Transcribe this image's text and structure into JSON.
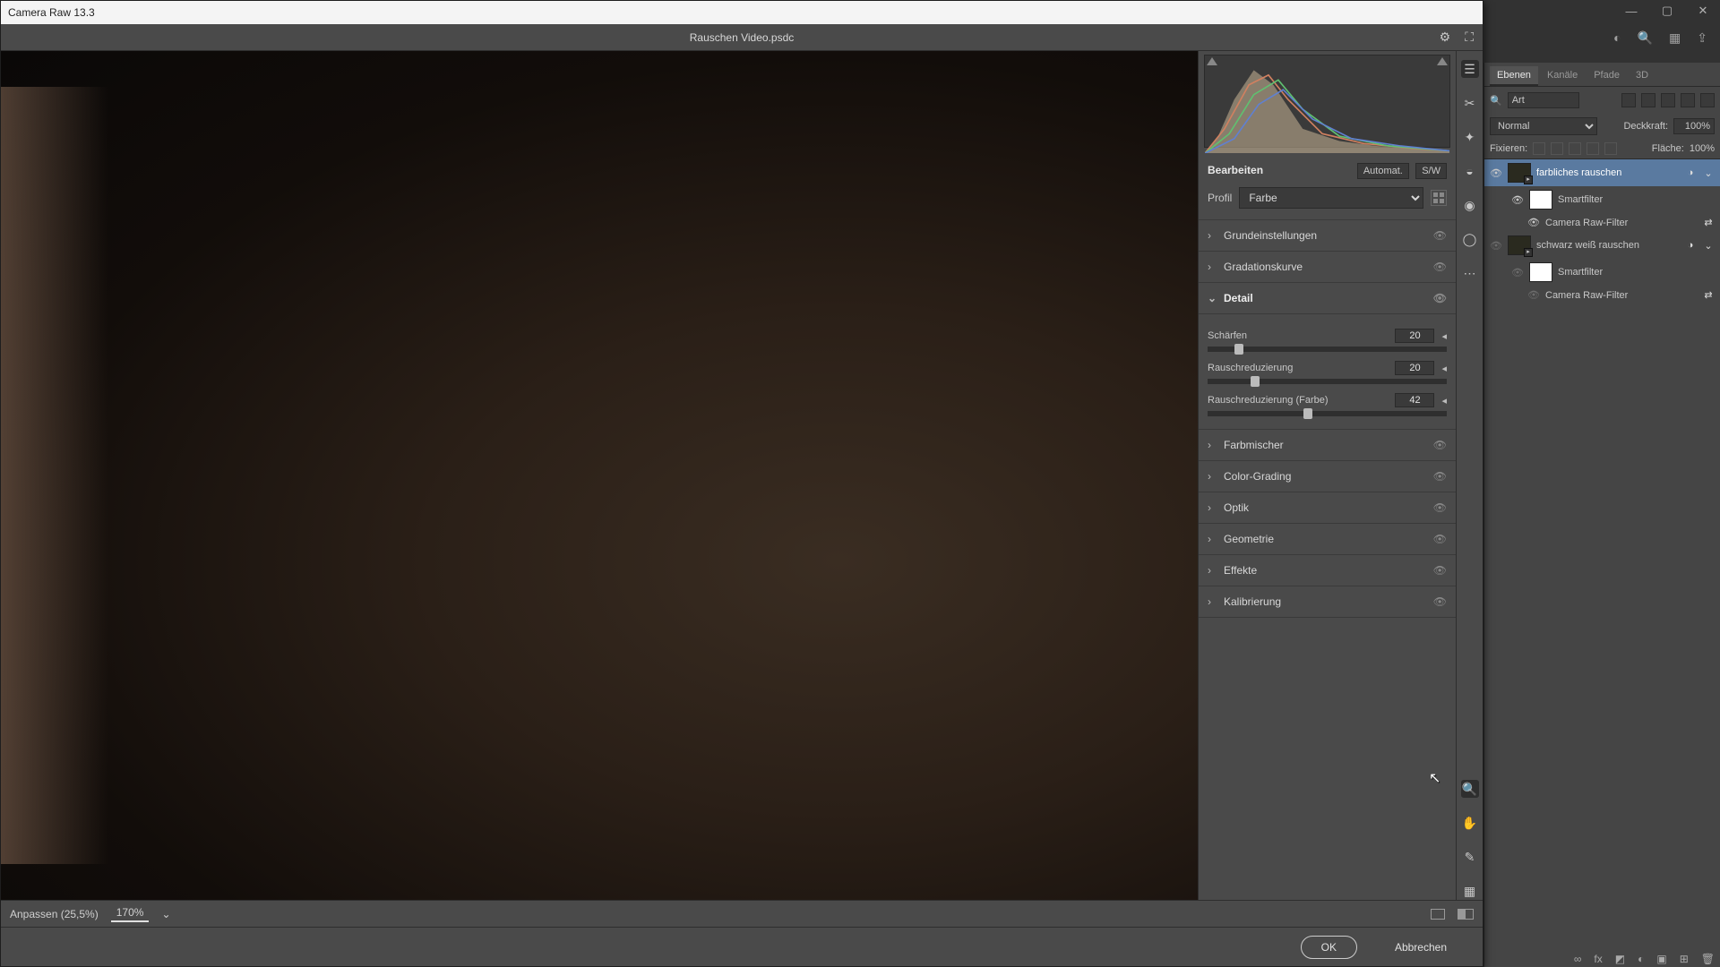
{
  "ps": {
    "tabs": [
      "Ebenen",
      "Kanäle",
      "Pfade",
      "3D"
    ],
    "filter_label": "Art",
    "blend_mode": "Normal",
    "opacity_label": "Deckkraft:",
    "opacity_value": "100%",
    "lock_label": "Fixieren:",
    "fill_label": "Fläche:",
    "fill_value": "100%",
    "layers": [
      {
        "name": "farbliches rauschen",
        "selected": true,
        "smart": true
      },
      {
        "name": "Smartfilter",
        "child": 1,
        "mask": true
      },
      {
        "name": "Camera Raw-Filter",
        "child": 2,
        "fx": true
      },
      {
        "name": "schwarz weiß rauschen",
        "smart": true
      },
      {
        "name": "Smartfilter",
        "child": 1,
        "mask": true
      },
      {
        "name": "Camera Raw-Filter",
        "child": 2,
        "fx": true
      }
    ]
  },
  "cr": {
    "title": "Camera Raw 13.3",
    "doc": "Rauschen Video.psdc",
    "edit_label": "Bearbeiten",
    "auto_label": "Automat.",
    "bw_label": "S/W",
    "profile_label": "Profil",
    "profile_value": "Farbe",
    "sections": {
      "basic": "Grundeinstellungen",
      "curve": "Gradationskurve",
      "detail": "Detail",
      "mixer": "Farbmischer",
      "grading": "Color-Grading",
      "optics": "Optik",
      "geometry": "Geometrie",
      "effects": "Effekte",
      "calib": "Kalibrierung"
    },
    "detail": {
      "sharpen_label": "Schärfen",
      "sharpen_value": "20",
      "nr_label": "Rauschreduzierung",
      "nr_value": "20",
      "cnr_label": "Rauschreduzierung (Farbe)",
      "cnr_value": "42"
    },
    "status": {
      "fit": "Anpassen (25,5%)",
      "zoom": "170%"
    },
    "ok": "OK",
    "cancel": "Abbrechen"
  }
}
